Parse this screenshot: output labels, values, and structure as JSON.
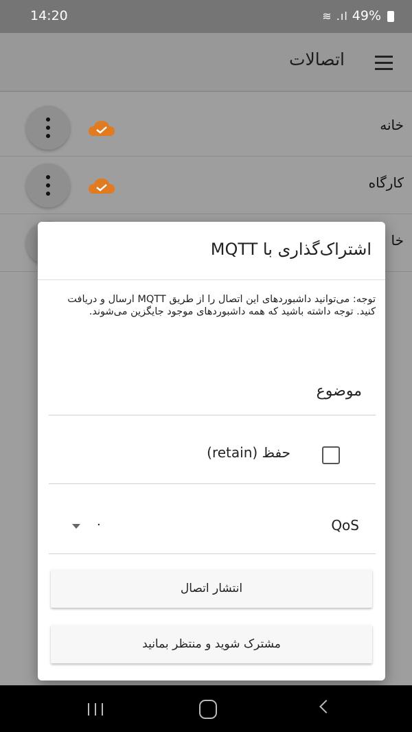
{
  "status": {
    "time": "14:20",
    "icons": "≈๑ .ıl",
    "battery": "49%"
  },
  "app_bar": {
    "title": "اتصالات"
  },
  "connections": [
    {
      "label": "خانه"
    },
    {
      "label": "کارگاه"
    },
    {
      "label": "خا"
    }
  ],
  "dialog": {
    "title": "اشتراک‌گذاری با MQTT",
    "note": "توجه: می‌توانید داشبوردهای این اتصال را از طریق MQTT ارسال و دریافت کنید. توجه داشته باشید که همه داشبوردهای موجود جایگزین می‌شوند.",
    "topic_label": "موضوع",
    "retain_label": "حفظ (retain)",
    "retain_checked": false,
    "qos_label": "QoS",
    "qos_value": "۰",
    "publish_button": "انتشار اتصال",
    "subscribe_button": "مشترک شوید و منتظر بمانید"
  },
  "colors": {
    "cloud": "#e07b22",
    "scrim": "#9e9e9e"
  }
}
